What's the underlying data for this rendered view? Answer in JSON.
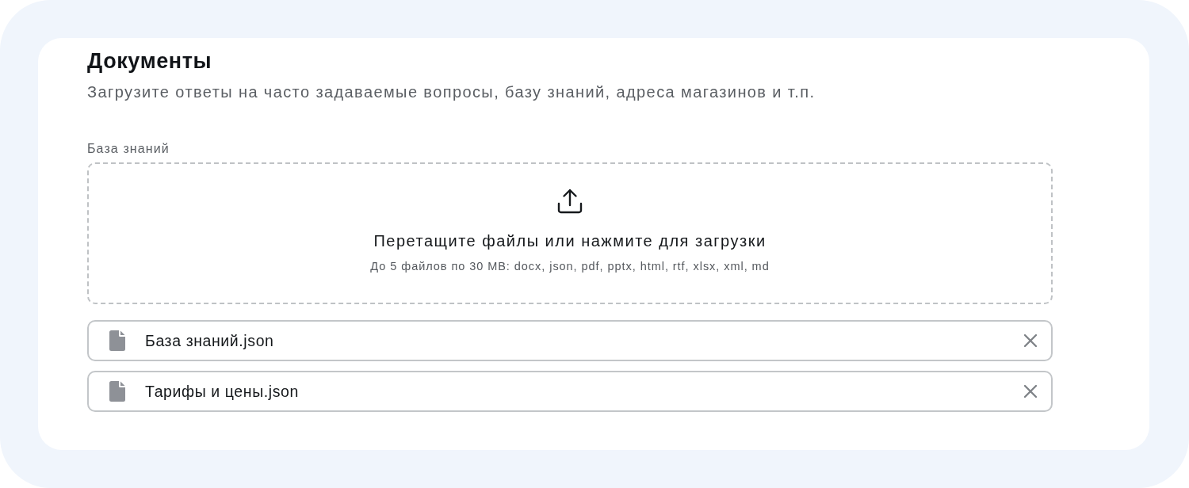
{
  "section": {
    "title": "Документы",
    "description": "Загрузите ответы на часто задаваемые вопросы, базу знаний, адреса магазинов и т.п."
  },
  "upload": {
    "label": "База знаний",
    "prompt": "Перетащите файлы или нажмите для загрузки",
    "hint": "До 5 файлов по 30 MB: docx, json, pdf, pptx, html, rtf, xlsx, xml, md"
  },
  "files": [
    {
      "name": "База знаний.json"
    },
    {
      "name": "Тарифы и цены.json"
    }
  ]
}
